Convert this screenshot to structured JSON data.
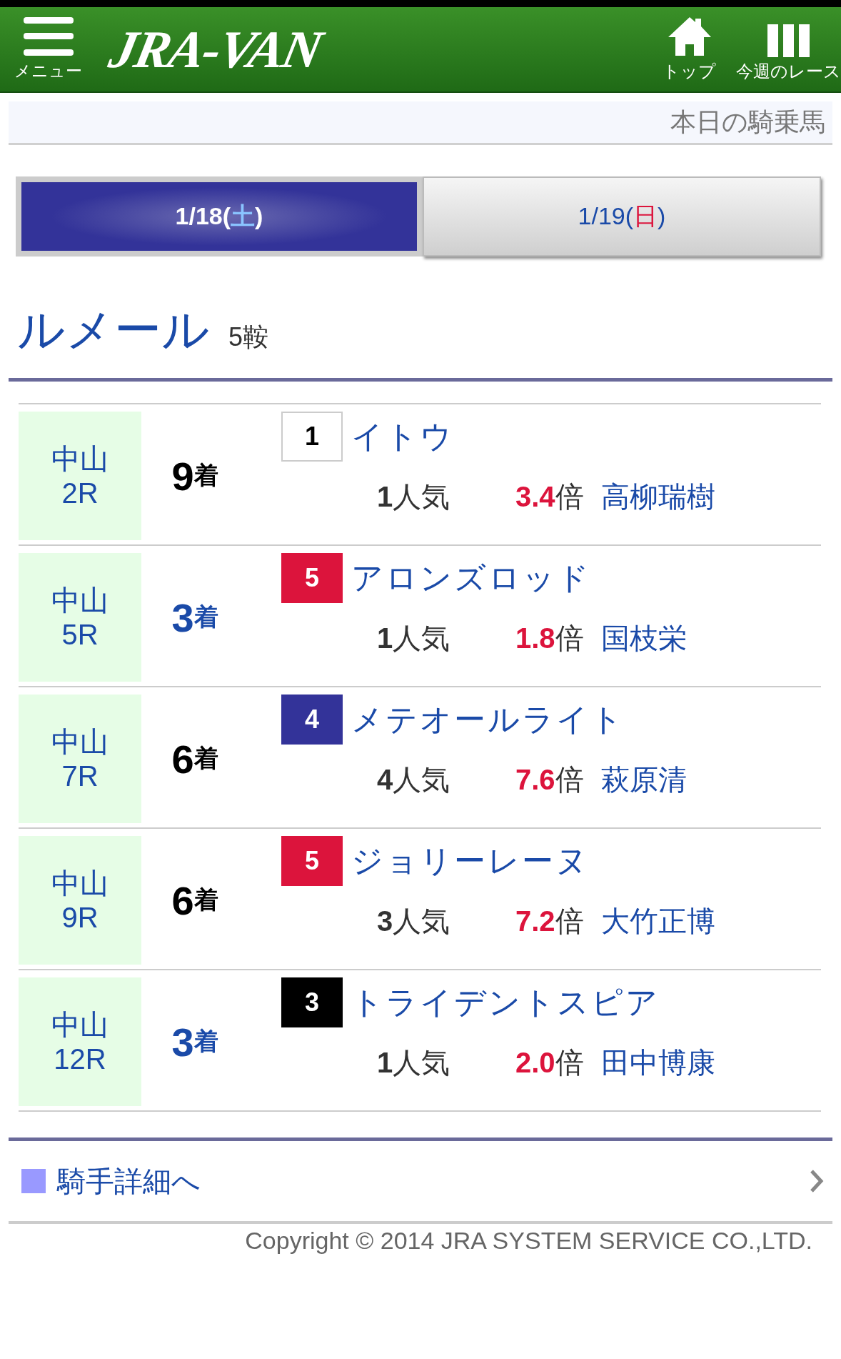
{
  "header": {
    "menu_label": "メニュー",
    "logo": "JRA-VAN",
    "nav": [
      {
        "kind": "home",
        "label": "トップ"
      },
      {
        "kind": "races",
        "label": "今週のレース"
      }
    ]
  },
  "subheader": {
    "title": "本日の騎乗馬"
  },
  "tabs": [
    {
      "prefix": "1/18(",
      "day": "土",
      "suffix": ")",
      "kind": "saturday",
      "selected": true
    },
    {
      "prefix": "1/19(",
      "day": "日",
      "suffix": ")",
      "kind": "sunday",
      "selected": false
    }
  ],
  "jockey": {
    "name": "ルメール",
    "mounts": "5鞍"
  },
  "rides": [
    {
      "venue": "中山",
      "race": "2R",
      "finish": "9",
      "finish_unit": "着",
      "placed": false,
      "gate": "1",
      "color": "#ffffff",
      "horse": "イトウ",
      "popularity": "**1**人気",
      "odds": "3.4",
      "odds_unit": "倍",
      "rider": "高柳瑞樹"
    },
    {
      "venue": "中山",
      "race": "5R",
      "finish": "3",
      "finish_unit": "着",
      "placed": true,
      "gate": "5",
      "color": "#dc143c",
      "horse": "アロンズロッド",
      "popularity": "**1**人気",
      "odds": "1.8",
      "odds_unit": "倍",
      "rider": "国枝栄"
    },
    {
      "venue": "中山",
      "race": "7R",
      "finish": "6",
      "finish_unit": "着",
      "placed": false,
      "gate": "4",
      "color": "#333399",
      "horse": "メテオールライト",
      "popularity": "**4**人気",
      "odds": "7.6",
      "odds_unit": "倍",
      "rider": "萩原清"
    },
    {
      "venue": "中山",
      "race": "9R",
      "finish": "6",
      "finish_unit": "着",
      "placed": false,
      "gate": "5",
      "color": "#dc143c",
      "horse": "ジョリーレーヌ",
      "popularity": "**3**人気",
      "odds": "7.2",
      "odds_unit": "倍",
      "rider": "大竹正博"
    },
    {
      "venue": "中山",
      "race": "12R",
      "finish": "3",
      "finish_unit": "着",
      "placed": true,
      "gate": "3",
      "color": "#000000",
      "horse": "トライデントスピア",
      "popularity": "**1**人気",
      "odds": "2.0",
      "odds_unit": "倍",
      "rider": "田中博康"
    }
  ],
  "detail_link": {
    "label": "騎手詳細へ"
  },
  "footer": {
    "copyright": "Copyright © 2014 JRA SYSTEM SERVICE CO.,LTD."
  }
}
